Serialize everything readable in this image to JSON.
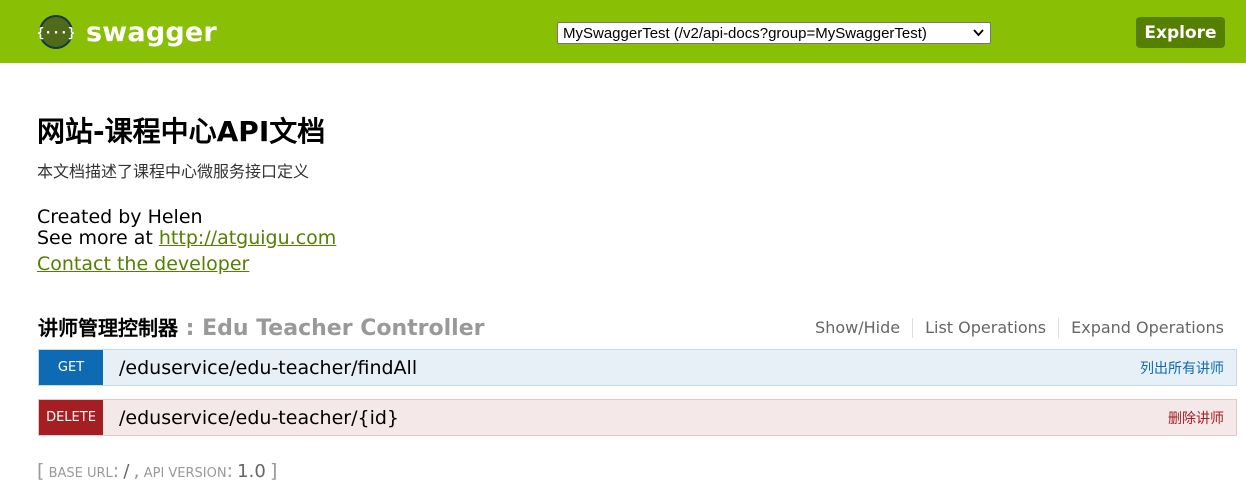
{
  "header": {
    "logo_text": "swagger",
    "api_select_value": "MySwaggerTest (/v2/api-docs?group=MySwaggerTest)",
    "explore_label": "Explore",
    "brand_color": "#89bf04",
    "button_color": "#547f00"
  },
  "info": {
    "title": "网站-课程中心API文档",
    "description": "本文档描述了课程中心微服务接口定义",
    "created_by": "Created by Helen",
    "see_more_prefix": "See more at ",
    "see_more_link": "http://atguigu.com",
    "contact_label": "Contact the developer"
  },
  "resource": {
    "name": "讲师管理控制器",
    "separator": " : ",
    "description": "Edu Teacher Controller",
    "ops": {
      "show_hide": "Show/Hide",
      "list_operations": "List Operations",
      "expand_operations": "Expand Operations"
    },
    "operations": [
      {
        "method": "GET",
        "path": "/eduservice/edu-teacher/findAll",
        "summary": "列出所有讲师",
        "color": "#0f6ab4"
      },
      {
        "method": "DELETE",
        "path": "/eduservice/edu-teacher/{id}",
        "summary": "删除讲师",
        "color": "#a41e22"
      }
    ]
  },
  "footer": {
    "open_bracket": "[",
    "base_url_label": "BASE URL",
    "base_url_value": "/",
    "api_version_label": "API VERSION",
    "api_version_value": "1.0",
    "close_bracket": "]"
  }
}
